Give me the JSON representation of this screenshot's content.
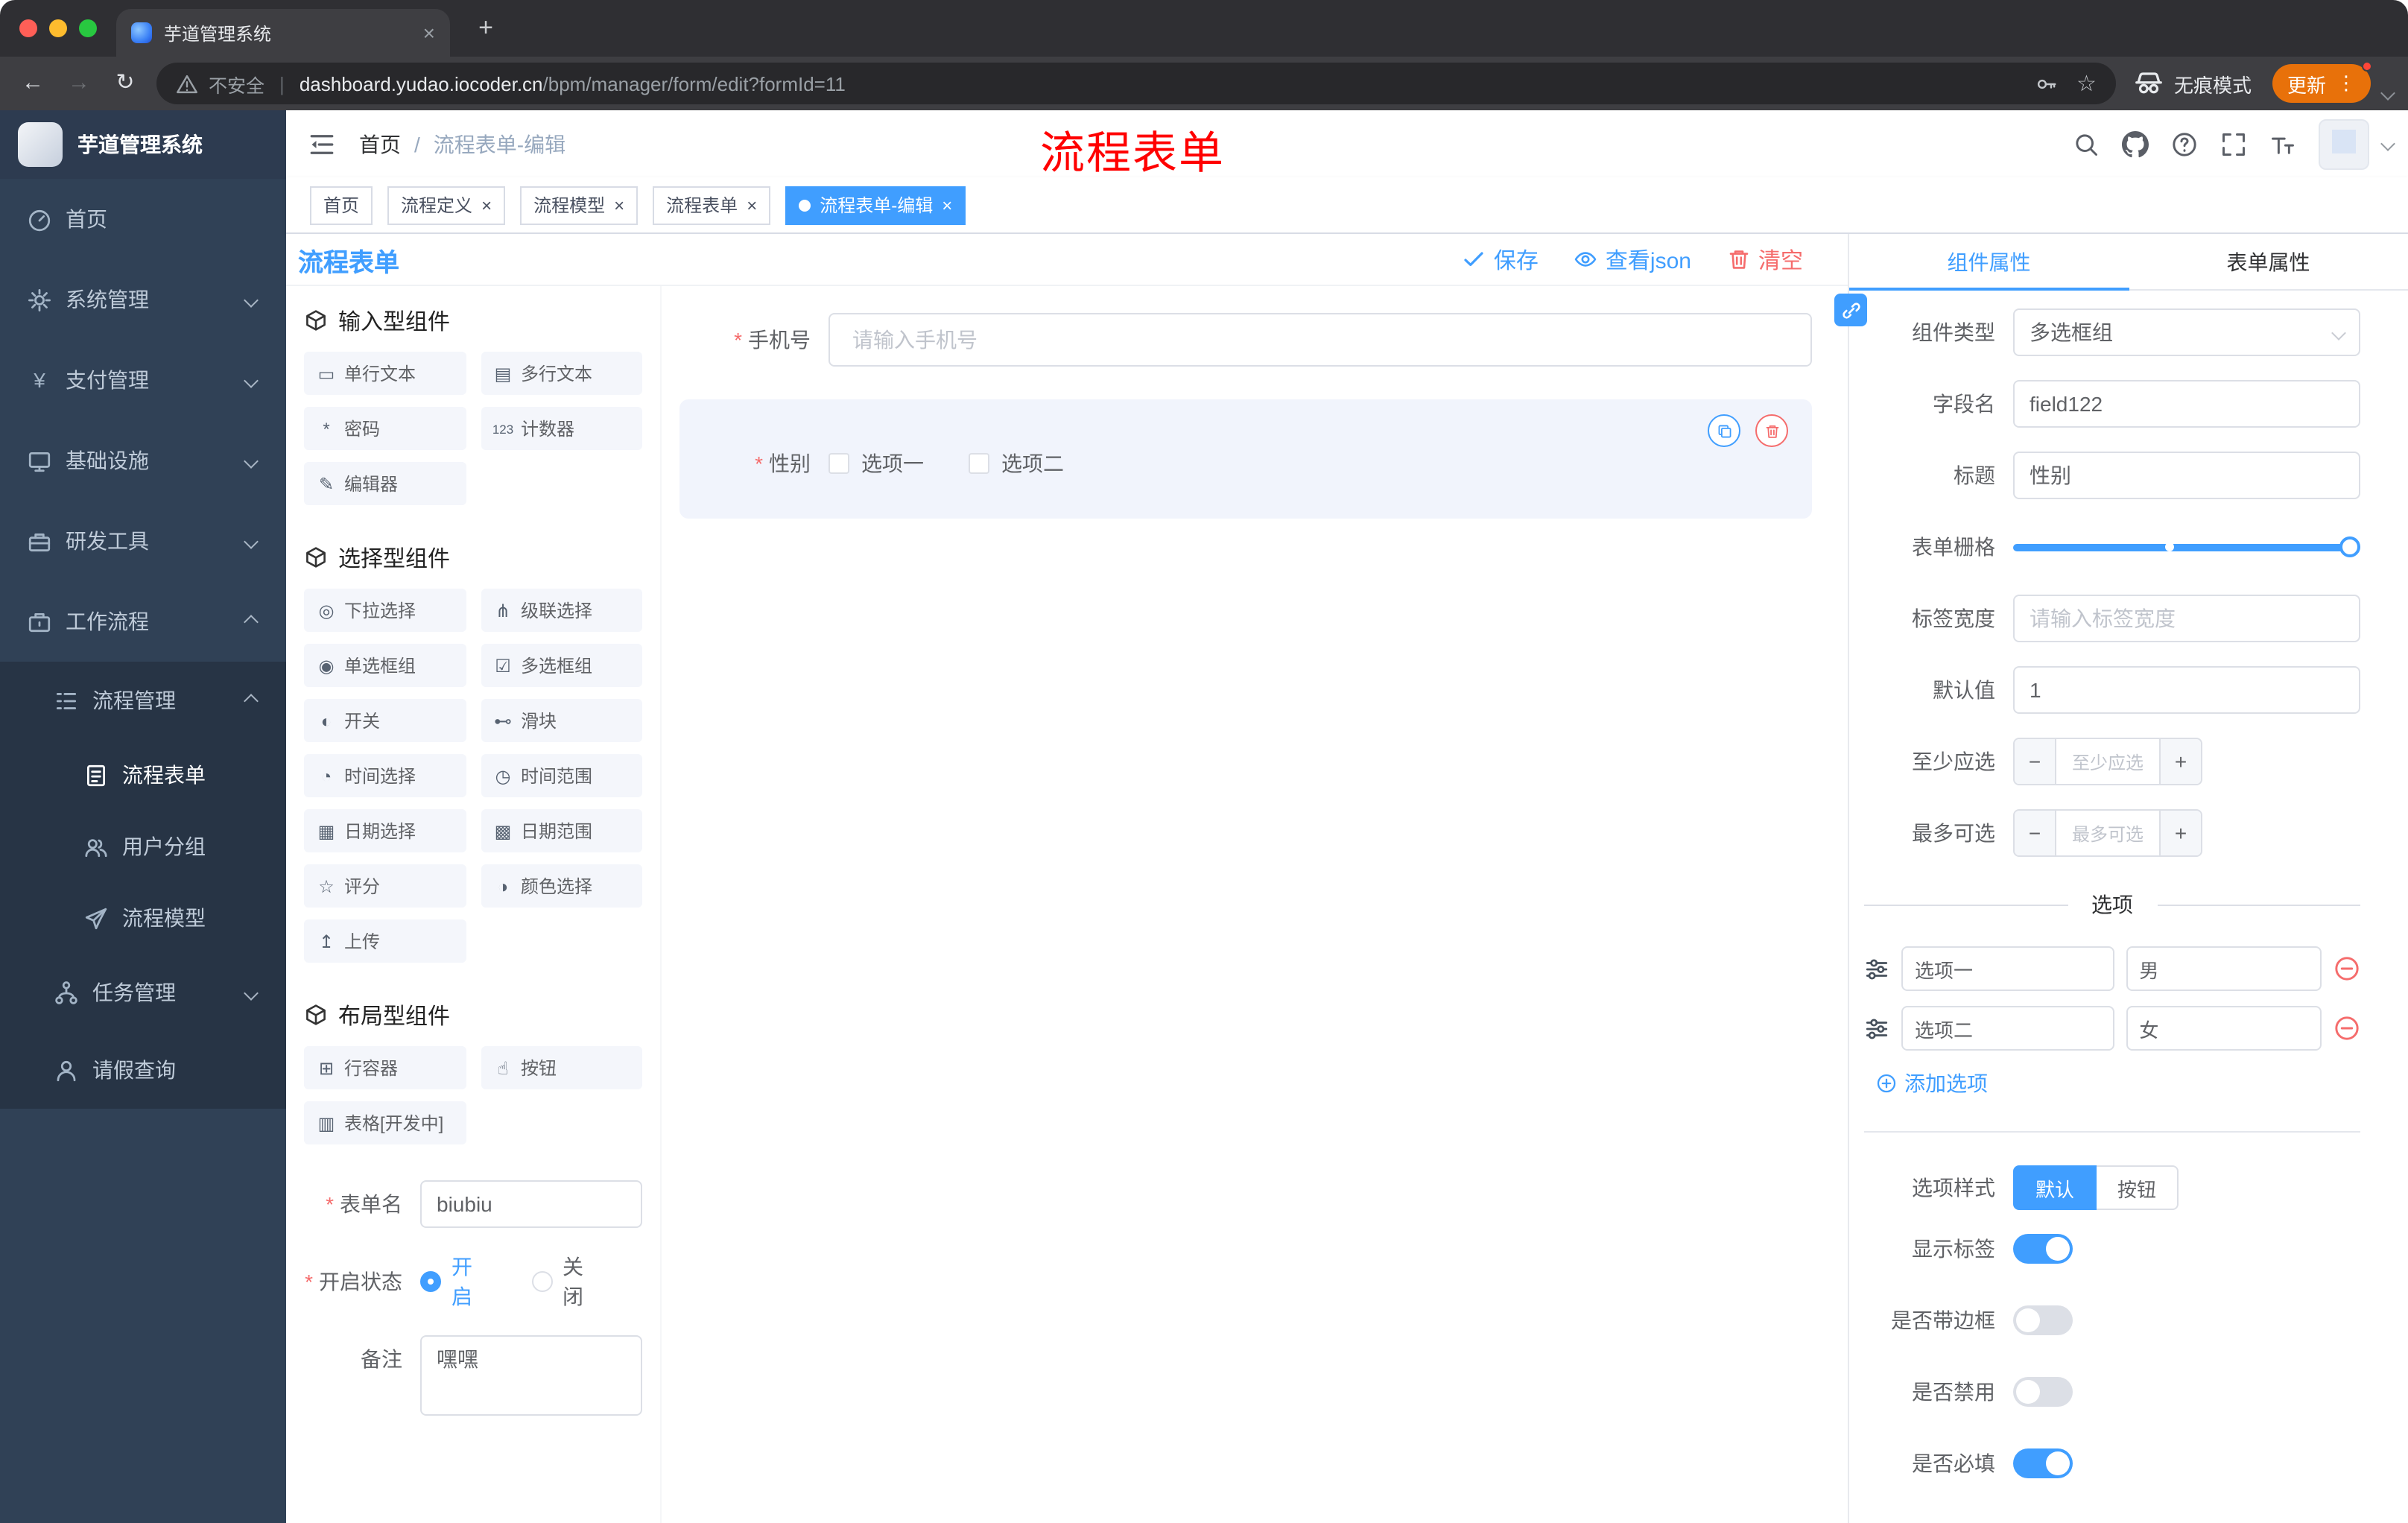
{
  "colors": {
    "accent": "#409eff",
    "danger": "#f56c6c",
    "annotation": "#ff0000",
    "update_chip": "#e8710a",
    "sidebar_bg": "#304156"
  },
  "browser": {
    "tab_title": "芋道管理系统",
    "security_label": "不安全",
    "url_host": "dashboard.yudao.iocoder.cn",
    "url_path": "/bpm/manager/form/edit?formId=11",
    "incognito_label": "无痕模式",
    "update_label": "更新"
  },
  "annotation": {
    "text": "流程表单"
  },
  "sidebar": {
    "logo_title": "芋道管理系统",
    "menu": [
      {
        "name": "home",
        "label": "首页",
        "icon": "dashboard",
        "level": 1
      },
      {
        "name": "system-management",
        "label": "系统管理",
        "icon": "gear",
        "level": 1,
        "chevron": "down"
      },
      {
        "name": "payment-management",
        "label": "支付管理",
        "icon": "yen",
        "level": 1,
        "chevron": "down"
      },
      {
        "name": "infrastructure",
        "label": "基础设施",
        "icon": "monitor",
        "level": 1,
        "chevron": "down"
      },
      {
        "name": "dev-tools",
        "label": "研发工具",
        "icon": "toolbox",
        "level": 1,
        "chevron": "down"
      },
      {
        "name": "workflow",
        "label": "工作流程",
        "icon": "briefcase",
        "level": 1,
        "chevron": "up"
      },
      {
        "name": "process-management",
        "label": "流程管理",
        "icon": "list",
        "level": 2,
        "chevron": "up",
        "in_expanded": true
      },
      {
        "name": "process-form",
        "label": "流程表单",
        "icon": "form",
        "level": 3,
        "active": true,
        "in_expanded": true
      },
      {
        "name": "user-group",
        "label": "用户分组",
        "icon": "users",
        "level": 3,
        "in_expanded": true
      },
      {
        "name": "process-model",
        "label": "流程模型",
        "icon": "send",
        "level": 3,
        "in_expanded": true
      },
      {
        "name": "task-management",
        "label": "任务管理",
        "icon": "tree",
        "level": 2,
        "chevron": "down",
        "in_expanded": true
      },
      {
        "name": "leave-query",
        "label": "请假查询",
        "icon": "user",
        "level": 2,
        "in_expanded": true
      }
    ]
  },
  "navbar": {
    "breadcrumb": [
      "首页",
      "流程表单-编辑"
    ]
  },
  "tags": [
    {
      "name": "home",
      "label": "首页",
      "closable": false,
      "active": false
    },
    {
      "name": "process-definition",
      "label": "流程定义",
      "closable": true,
      "active": false
    },
    {
      "name": "process-model",
      "label": "流程模型",
      "closable": true,
      "active": false
    },
    {
      "name": "process-form",
      "label": "流程表单",
      "closable": true,
      "active": false
    },
    {
      "name": "process-form-edit",
      "label": "流程表单-编辑",
      "closable": true,
      "active": true
    }
  ],
  "designer": {
    "title": "流程表单",
    "actions": {
      "save": "保存",
      "view_json": "查看json",
      "clear": "清空"
    },
    "sections": [
      {
        "title": "输入型组件",
        "items": [
          {
            "name": "single-line-text",
            "label": "单行文本",
            "glyph": "▭"
          },
          {
            "name": "multiline-text",
            "label": "多行文本",
            "glyph": "▤"
          },
          {
            "name": "password",
            "label": "密码",
            "glyph": "*"
          },
          {
            "name": "counter",
            "label": "计数器",
            "glyph": "123"
          },
          {
            "name": "editor",
            "label": "编辑器",
            "glyph": "✎"
          }
        ]
      },
      {
        "title": "选择型组件",
        "items": [
          {
            "name": "select",
            "label": "下拉选择",
            "glyph": "◎"
          },
          {
            "name": "cascader",
            "label": "级联选择",
            "glyph": "⋔"
          },
          {
            "name": "radio-group",
            "label": "单选框组",
            "glyph": "◉"
          },
          {
            "name": "checkbox-group",
            "label": "多选框组",
            "glyph": "☑"
          },
          {
            "name": "switch",
            "label": "开关",
            "glyph": "◐"
          },
          {
            "name": "slider",
            "label": "滑块",
            "glyph": "⊷"
          },
          {
            "name": "time-picker",
            "label": "时间选择",
            "glyph": "◔"
          },
          {
            "name": "time-range",
            "label": "时间范围",
            "glyph": "◷"
          },
          {
            "name": "date-picker",
            "label": "日期选择",
            "glyph": "▦"
          },
          {
            "name": "date-range",
            "label": "日期范围",
            "glyph": "▩"
          },
          {
            "name": "rate",
            "label": "评分",
            "glyph": "☆"
          },
          {
            "name": "color-picker",
            "label": "颜色选择",
            "glyph": "◑"
          },
          {
            "name": "upload",
            "label": "上传",
            "glyph": "↥"
          }
        ]
      },
      {
        "title": "布局型组件",
        "items": [
          {
            "name": "row-container",
            "label": "行容器",
            "glyph": "⊞"
          },
          {
            "name": "button",
            "label": "按钮",
            "glyph": "☝"
          },
          {
            "name": "table-dev",
            "label": "表格[开发中]",
            "glyph": "▥"
          }
        ]
      }
    ],
    "form_meta": {
      "name_label": "表单名",
      "name_value": "biubiu",
      "status_label": "开启状态",
      "status_on": "开启",
      "status_off": "关闭",
      "remark_label": "备注",
      "remark_value": "嘿嘿"
    },
    "canvas": {
      "phone_label": "手机号",
      "phone_placeholder": "请输入手机号",
      "gender_label": "性别",
      "gender_options": [
        "选项一",
        "选项二"
      ]
    }
  },
  "props": {
    "tabs": [
      "组件属性",
      "表单属性"
    ],
    "active_tab": "组件属性",
    "component_type_label": "组件类型",
    "component_type_value": "多选框组",
    "field_name_label": "字段名",
    "field_name_value": "field122",
    "title_label": "标题",
    "title_value": "性别",
    "grid_label": "表单栅格",
    "label_width_label": "标签宽度",
    "label_width_placeholder": "请输入标签宽度",
    "default_label": "默认值",
    "default_value": "1",
    "min_label": "至少应选",
    "min_placeholder": "至少应选",
    "max_label": "最多可选",
    "max_placeholder": "最多可选",
    "options_title": "选项",
    "options": [
      {
        "label": "选项一",
        "value": "男"
      },
      {
        "label": "选项二",
        "value": "女"
      }
    ],
    "add_option_label": "添加选项",
    "style_label": "选项样式",
    "style_options": [
      "默认",
      "按钮"
    ],
    "style_active": "默认",
    "toggles": [
      {
        "name": "show-label",
        "label": "显示标签",
        "on": true
      },
      {
        "name": "with-border",
        "label": "是否带边框",
        "on": false
      },
      {
        "name": "disabled",
        "label": "是否禁用",
        "on": false
      },
      {
        "name": "required",
        "label": "是否必填",
        "on": true
      }
    ]
  }
}
